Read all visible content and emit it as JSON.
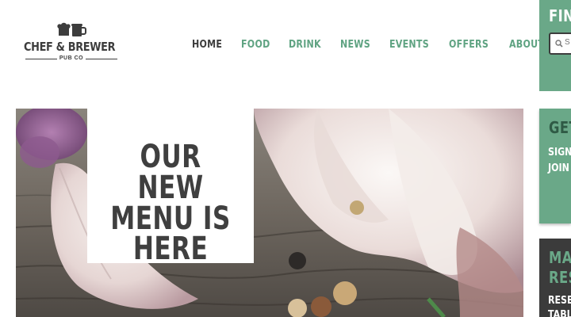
{
  "logo": {
    "name": "CHEF & BREWER",
    "sub": "PUB CO"
  },
  "nav": {
    "items": [
      "HOME",
      "FOOD",
      "DRINK",
      "NEWS",
      "EVENTS",
      "OFFERS",
      "ABOUT"
    ],
    "active_index": 0
  },
  "hero": {
    "title_lines": [
      "OUR NEW",
      "MENU IS",
      "HERE"
    ]
  },
  "sidebar": {
    "find": {
      "heading": "FIN",
      "search_placeholder": "S"
    },
    "get": {
      "heading": "GET",
      "lines": [
        "SIGN",
        "JOIN"
      ]
    },
    "make": {
      "heading_lines": [
        "MA",
        "RES"
      ],
      "lines": [
        "RESE",
        "TABL"
      ]
    }
  },
  "colors": {
    "accent_green": "#6aa888",
    "nav_green": "#5fa382",
    "dark_text": "#3d3d3d",
    "dark_panel": "#3b3b3b"
  }
}
